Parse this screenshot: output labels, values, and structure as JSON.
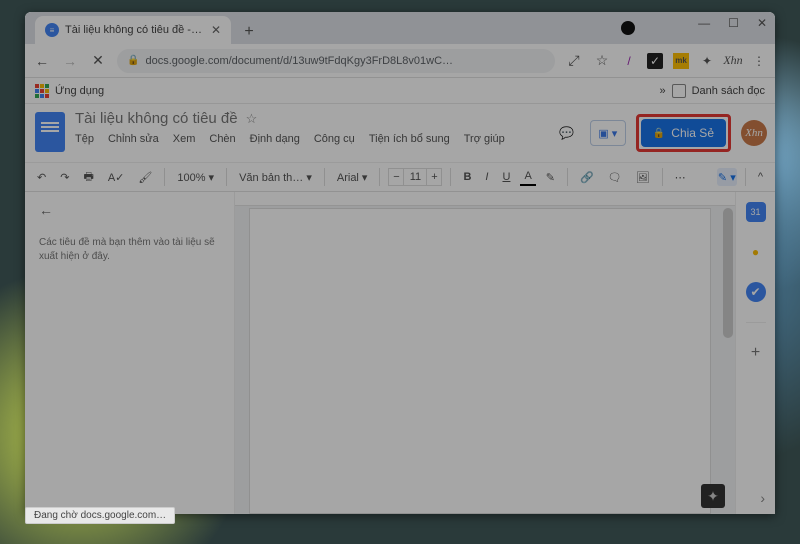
{
  "browser": {
    "tab_title": "Tài liệu không có tiêu đề - Googl",
    "new_tab": "+",
    "window_controls": {
      "min": "—",
      "max": "☐",
      "close": "✕"
    },
    "nav": {
      "back": "←",
      "forward": "→",
      "stop": "✕"
    },
    "url": "docs.google.com/document/d/13uw9tFdqKgy3FrD8L8v01wC…",
    "actions": {
      "search": "⤢",
      "star": "☆"
    },
    "extensions": [
      "/",
      "✓",
      "mk",
      "✦",
      "Xhn",
      "⋮"
    ],
    "bookmarks": {
      "apps": "Ứng dụng",
      "reading_list": "Danh sách đọc",
      "overflow": "»"
    }
  },
  "docs": {
    "title": "Tài liệu không có tiêu đề",
    "star": "☆",
    "menus": [
      "Tệp",
      "Chỉnh sửa",
      "Xem",
      "Chèn",
      "Định dạng",
      "Công cụ",
      "Tiện ích bổ sung",
      "Trợ giúp"
    ],
    "comments_icon": "💬",
    "present_icon": "▣ ▾",
    "share": {
      "lock": "🔒",
      "label": "Chia Sẻ"
    },
    "avatar": "Xhn"
  },
  "toolbar": {
    "undo": "↶",
    "redo": "↷",
    "print": "🖶",
    "spell": "A✓",
    "paint": "🖌",
    "zoom": "100%  ▾",
    "styles": "Văn bản th…  ▾",
    "font": "Arial          ▾",
    "size": "11",
    "bold": "B",
    "italic": "I",
    "underline": "U",
    "textcolor": "A",
    "highlight": "✎",
    "link": "🔗",
    "addcomment": "🗨",
    "image": "🖼",
    "more": "⋯",
    "pen": "✎ ▾",
    "collapse": "^"
  },
  "outline": {
    "back": "←",
    "placeholder": "Các tiêu đề mà bạn thêm vào tài liệu sẽ xuất hiện ở đây."
  },
  "sidepanel": {
    "calendar": "31",
    "keep": "●",
    "tasks": "✔",
    "plus": "+"
  },
  "footer": {
    "keep_bottom": "✦",
    "expand": "›"
  },
  "status": "Đang chờ docs.google.com…"
}
